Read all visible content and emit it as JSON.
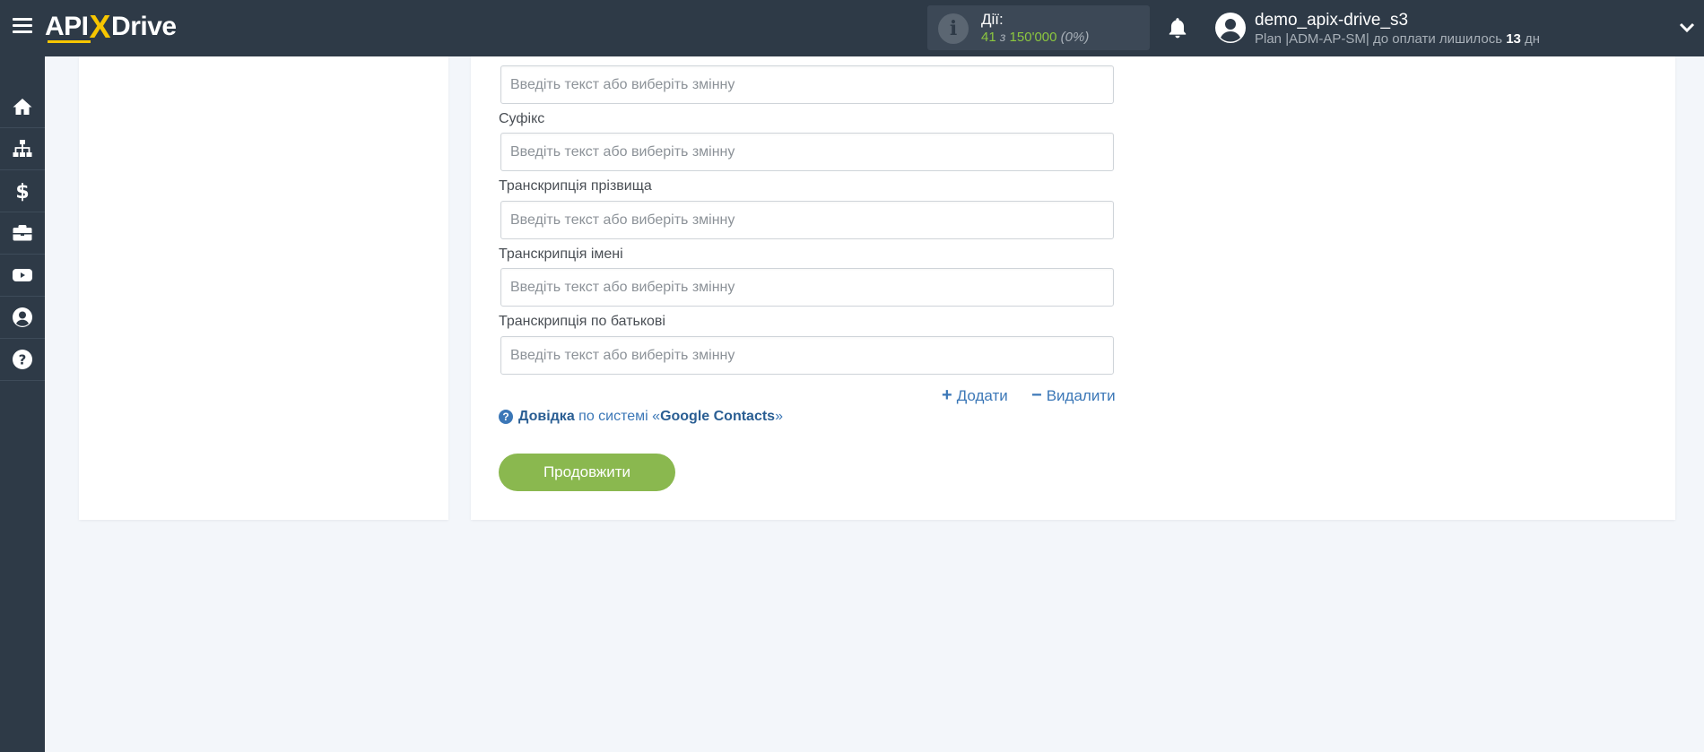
{
  "header": {
    "logo": {
      "api": "API",
      "x": "X",
      "drive": "Drive"
    },
    "actions": {
      "label": "Дії:",
      "used": "41",
      "of": "з",
      "total": "150'000",
      "percent": "(0%)"
    },
    "user": {
      "name": "demo_apix-drive_s3",
      "plan_prefix": "Plan |ADM-AP-SM| до оплати лишилось",
      "days": "13",
      "days_unit": "дн"
    }
  },
  "sidebar": {
    "items": [
      {
        "name": "home-icon"
      },
      {
        "name": "sitemap-icon"
      },
      {
        "name": "dollar-icon"
      },
      {
        "name": "briefcase-icon"
      },
      {
        "name": "youtube-icon"
      },
      {
        "name": "user-circle-icon"
      },
      {
        "name": "question-circle-icon"
      }
    ]
  },
  "form": {
    "fields": [
      {
        "label": "",
        "placeholder": "Введіть текст або виберіть змінну"
      },
      {
        "label": "Суфікс",
        "placeholder": "Введіть текст або виберіть змінну"
      },
      {
        "label": "Транскрипція прізвища",
        "placeholder": "Введіть текст або виберіть змінну"
      },
      {
        "label": "Транскрипція імені",
        "placeholder": "Введіть текст або виберіть змінну"
      },
      {
        "label": "Транскрипція по батькові",
        "placeholder": "Введіть текст або виберіть змінну"
      }
    ],
    "add_label": "Додати",
    "remove_label": "Видалити",
    "help": {
      "bold": "Довідка",
      "middle": "по системі «",
      "service": "Google Contacts",
      "end": "»"
    },
    "continue_label": "Продовжити"
  },
  "colors": {
    "topbar": "#2e3a47",
    "accent_green": "#8ab84f",
    "link_blue": "#3b77b7",
    "logo_yellow": "#f7c600"
  }
}
